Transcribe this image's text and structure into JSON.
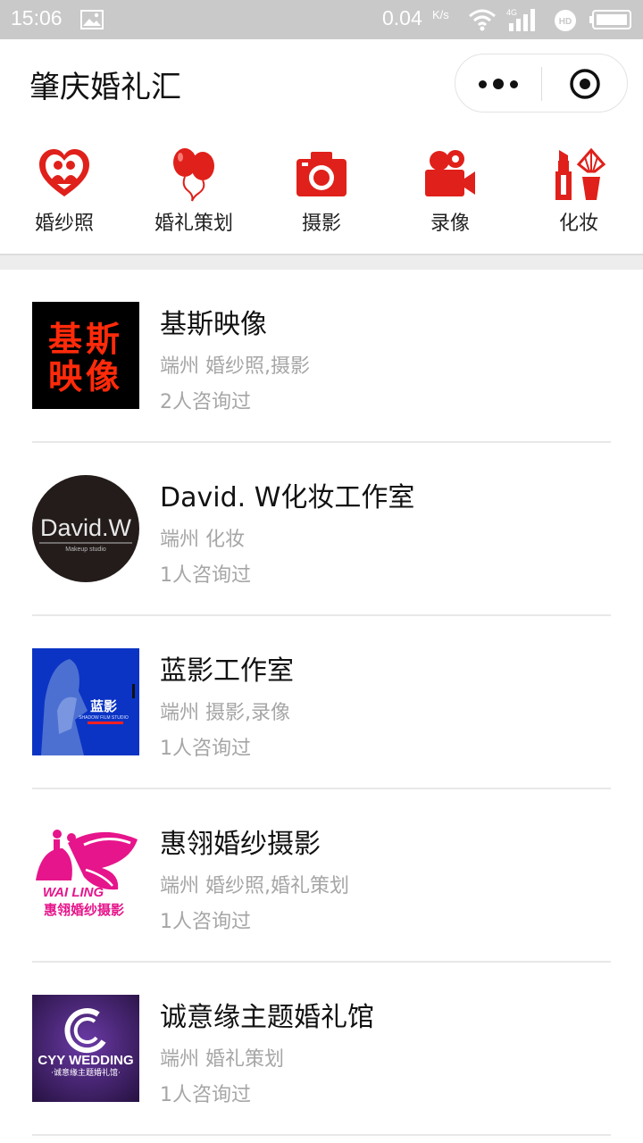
{
  "status_bar": {
    "time": "15:06",
    "net_speed": "0.04",
    "net_unit": "K/s",
    "signal_label": "4G",
    "hd_label": "HD",
    "icons": [
      "image-icon",
      "wifi-icon",
      "signal-icon",
      "hd-icon",
      "battery-icon"
    ]
  },
  "header": {
    "title": "肇庆婚礼汇",
    "more_icon": "more-dots-icon",
    "close_icon": "close-target-icon"
  },
  "categories": [
    {
      "label": "婚纱照",
      "icon": "heart-couple-icon"
    },
    {
      "label": "婚礼策划",
      "icon": "balloons-icon"
    },
    {
      "label": "摄影",
      "icon": "camera-icon"
    },
    {
      "label": "录像",
      "icon": "video-camera-icon"
    },
    {
      "label": "化妆",
      "icon": "makeup-icon"
    }
  ],
  "accent_color": "#e0201a",
  "listings": [
    {
      "name": "基斯映像",
      "meta": "端州 婚纱照,摄影",
      "consult": "2人咨询过",
      "logo_text": [
        "基斯",
        "映像"
      ]
    },
    {
      "name": "David. W化妆工作室",
      "meta": "端州 化妆",
      "consult": "1人咨询过",
      "logo_text": [
        "David.W",
        "Makeup studio"
      ]
    },
    {
      "name": "蓝影工作室",
      "meta": "端州 摄影,录像",
      "consult": "1人咨询过",
      "logo_text": [
        "蓝影",
        "SHADOW FILM STUDIO"
      ]
    },
    {
      "name": "惠翎婚纱摄影",
      "meta": "端州 婚纱照,婚礼策划",
      "consult": "1人咨询过",
      "logo_text": [
        "WAI LING",
        "惠翎婚纱摄影"
      ]
    },
    {
      "name": "诚意缘主题婚礼馆",
      "meta": "端州 婚礼策划",
      "consult": "1人咨询过",
      "logo_text": [
        "CYY WEDDING",
        "·诚意缘主题婚礼馆·"
      ]
    }
  ]
}
